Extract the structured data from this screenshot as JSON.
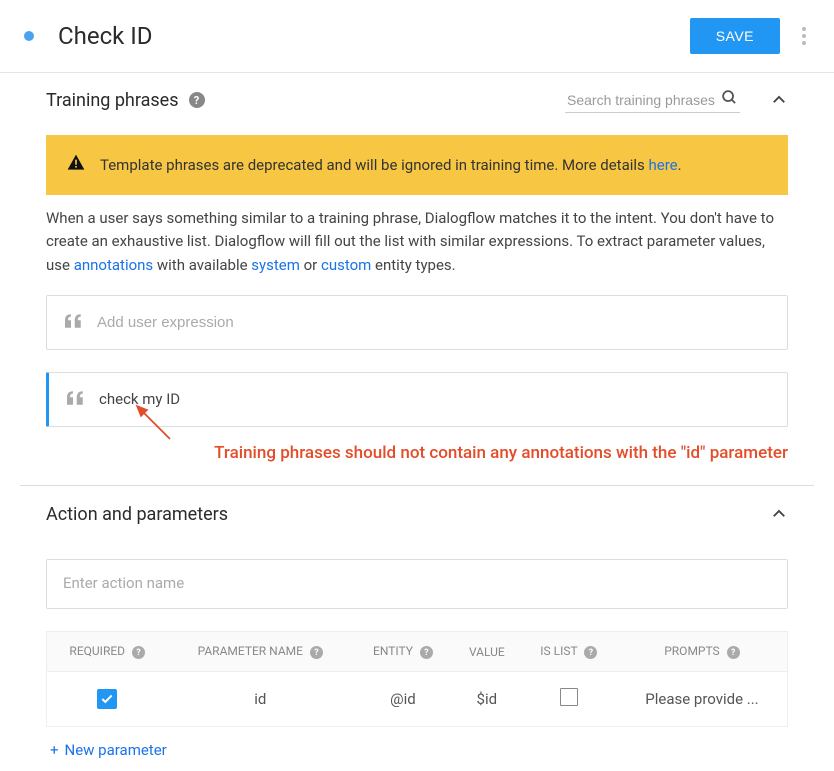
{
  "header": {
    "title": "Check ID",
    "save_label": "SAVE"
  },
  "training": {
    "section_title": "Training phrases",
    "search_placeholder": "Search training phrases",
    "warning_text": "Template phrases are deprecated and will be ignored in training time. More details ",
    "warning_link": "here",
    "desc_prefix": "When a user says something similar to a training phrase, Dialogflow matches it to the intent. You don't have to create an exhaustive list. Dialogflow will fill out the list with similar expressions. To extract parameter values, use ",
    "desc_link_annotations": "annotations",
    "desc_mid1": " with available ",
    "desc_link_system": "system",
    "desc_mid2": " or ",
    "desc_link_custom": "custom",
    "desc_suffix": " entity types.",
    "add_placeholder": "Add user expression",
    "phrase1": "check my ID"
  },
  "annotation_note": "Training phrases should not contain any annotations with the \"id\" parameter",
  "action": {
    "section_title": "Action and parameters",
    "action_placeholder": "Enter action name",
    "headers": {
      "required": "REQUIRED",
      "param_name": "PARAMETER NAME",
      "entity": "ENTITY",
      "value": "VALUE",
      "is_list": "IS LIST",
      "prompts": "PROMPTS"
    },
    "rows": [
      {
        "required": true,
        "name": "id",
        "entity": "@id",
        "value": "$id",
        "is_list": false,
        "prompt": "Please provide ..."
      }
    ],
    "new_param_label": "New parameter"
  }
}
